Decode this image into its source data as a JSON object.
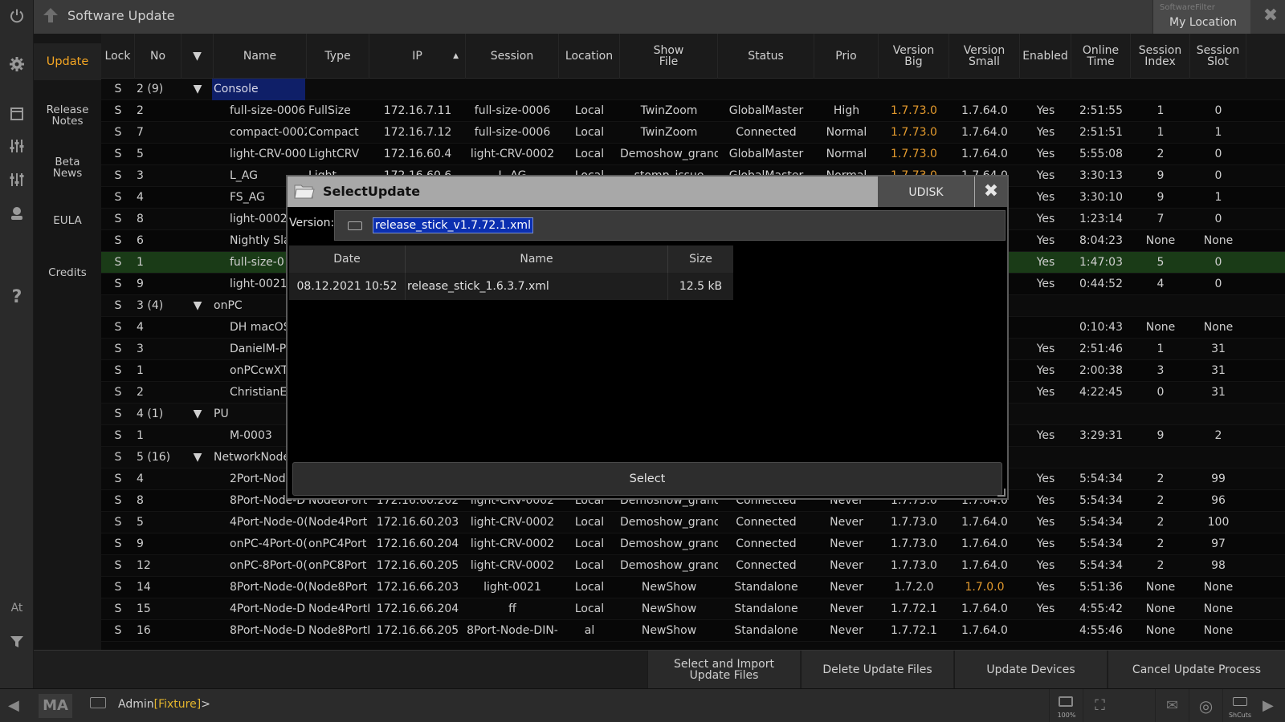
{
  "app": {
    "title": "Software Update",
    "filter_small": "SoftwareFilter",
    "filter_main": "My Location"
  },
  "rail": {
    "icons": [
      "power-icon",
      "gear-icon",
      "window-icon",
      "faders-icon",
      "faders-alt-icon",
      "user-icon",
      "help-icon",
      "filter-icon"
    ],
    "at_label": "At"
  },
  "sidemenu": {
    "update": "Update",
    "release_notes": "Release\nNotes",
    "beta_news": "Beta\nNews",
    "eula": "EULA",
    "credits": "Credits"
  },
  "table": {
    "headers": {
      "lock": "Lock",
      "no": "No",
      "name": "Name",
      "type": "Type",
      "ip": "IP",
      "session": "Session",
      "location": "Location",
      "show_file": "Show\nFile",
      "status": "Status",
      "prio": "Prio",
      "version_big": "Version\nBig",
      "version_small": "Version\nSmall",
      "enabled": "Enabled",
      "online_time": "Online\nTime",
      "session_index": "Session\nIndex",
      "session_slot": "Session\nSlot"
    },
    "rows": [
      {
        "kind": "group",
        "lock": "S",
        "no": "2 (9)",
        "name": "Console"
      },
      {
        "lock": "S",
        "no": "2",
        "name": "full-size-0006",
        "type": "FullSize",
        "ip": "172.16.7.11",
        "session": "full-size-0006",
        "location": "Local",
        "show": "TwinZoom",
        "status": "GlobalMaster",
        "prio": "High",
        "vbig": "1.7.73.0",
        "vbig_orange": true,
        "vsmall": "1.7.64.0",
        "enabled": "Yes",
        "online": "2:51:55",
        "sindex": "1",
        "sslot": "0"
      },
      {
        "lock": "S",
        "no": "7",
        "name": "compact-0002",
        "type": "Compact",
        "ip": "172.16.7.12",
        "session": "full-size-0006",
        "location": "Local",
        "show": "TwinZoom",
        "status": "Connected",
        "prio": "Normal",
        "vbig": "1.7.73.0",
        "vbig_orange": true,
        "vsmall": "1.7.64.0",
        "enabled": "Yes",
        "online": "2:51:51",
        "sindex": "1",
        "sslot": "1"
      },
      {
        "lock": "S",
        "no": "5",
        "name": "light-CRV-000",
        "type": "LightCRV",
        "ip": "172.16.60.4",
        "session": "light-CRV-0002",
        "location": "Local",
        "show": "Demoshow_grand",
        "status": "GlobalMaster",
        "prio": "Normal",
        "vbig": "1.7.73.0",
        "vbig_orange": true,
        "vsmall": "1.7.64.0",
        "enabled": "Yes",
        "online": "5:55:08",
        "sindex": "2",
        "sslot": "0"
      },
      {
        "lock": "S",
        "no": "3",
        "name": "L_AG",
        "type": "Light",
        "ip": "172.16.60.6",
        "session": "L_AG",
        "location": "Local",
        "show": "stomp_issue",
        "status": "GlobalMaster",
        "prio": "Normal",
        "vbig": "1.7.73.0",
        "vbig_orange": true,
        "vsmall": "1.7.64.0",
        "enabled": "Yes",
        "online": "3:30:13",
        "sindex": "9",
        "sslot": "0"
      },
      {
        "lock": "S",
        "no": "4",
        "name": "FS_AG",
        "type": "",
        "ip": "",
        "session": "",
        "location": "",
        "show": "",
        "status": "",
        "prio": "",
        "vbig": "",
        "vsmall": "",
        "enabled": "Yes",
        "online": "3:30:10",
        "sindex": "9",
        "sslot": "1"
      },
      {
        "lock": "S",
        "no": "8",
        "name": "light-0002",
        "type": "",
        "ip": "",
        "session": "",
        "location": "",
        "show": "",
        "status": "",
        "prio": "",
        "vbig": "",
        "vsmall": "",
        "enabled": "Yes",
        "online": "1:23:14",
        "sindex": "7",
        "sslot": "0"
      },
      {
        "lock": "S",
        "no": "6",
        "name": "Nightly Sla",
        "type": "",
        "ip": "",
        "session": "",
        "location": "",
        "show": "",
        "status": "",
        "prio": "",
        "vbig": "",
        "vsmall": "",
        "enabled": "Yes",
        "online": "8:04:23",
        "sindex": "None",
        "sslot": "None"
      },
      {
        "lock": "S",
        "no": "1",
        "name": "full-size-0",
        "sel": true,
        "type": "",
        "ip": "",
        "session": "",
        "location": "",
        "show": "",
        "status": "",
        "prio": "",
        "vbig": "",
        "vsmall": "",
        "enabled": "Yes",
        "online": "1:47:03",
        "sindex": "5",
        "sslot": "0"
      },
      {
        "lock": "S",
        "no": "9",
        "name": "light-0021",
        "type": "",
        "ip": "",
        "session": "",
        "location": "",
        "show": "",
        "status": "",
        "prio": "",
        "vbig": "",
        "vsmall": "",
        "enabled": "Yes",
        "online": "0:44:52",
        "sindex": "4",
        "sslot": "0"
      },
      {
        "kind": "group",
        "lock": "S",
        "no": "3 (4)",
        "name": "onPC"
      },
      {
        "lock": "S",
        "no": "4",
        "name": "DH macOS",
        "type": "",
        "ip": "",
        "session": "",
        "location": "",
        "show": "",
        "status": "",
        "prio": "",
        "vbig": "",
        "vsmall": "",
        "enabled": "",
        "online": "0:10:43",
        "sindex": "None",
        "sslot": "None"
      },
      {
        "lock": "S",
        "no": "3",
        "name": "DanielM-P",
        "type": "",
        "ip": "",
        "session": "",
        "location": "",
        "show": "",
        "status": "",
        "prio": "",
        "vbig": "",
        "vsmall": "",
        "enabled": "Yes",
        "online": "2:51:46",
        "sindex": "1",
        "sslot": "31"
      },
      {
        "lock": "S",
        "no": "1",
        "name": "onPCcwXT",
        "type": "",
        "ip": "",
        "session": "",
        "location": "",
        "show": "",
        "status": "",
        "prio": "",
        "vbig": "",
        "vsmall": "",
        "enabled": "Yes",
        "online": "2:00:38",
        "sindex": "3",
        "sslot": "31"
      },
      {
        "lock": "S",
        "no": "2",
        "name": "ChristianE",
        "type": "",
        "ip": "",
        "session": "",
        "location": "",
        "show": "",
        "status": "",
        "prio": "",
        "vbig": "",
        "vsmall": "",
        "enabled": "Yes",
        "online": "4:22:45",
        "sindex": "0",
        "sslot": "31"
      },
      {
        "kind": "group",
        "lock": "S",
        "no": "4 (1)",
        "name": "PU"
      },
      {
        "lock": "S",
        "no": "1",
        "name": "M-0003",
        "type": "",
        "ip": "",
        "session": "",
        "location": "",
        "show": "",
        "status": "",
        "prio": "",
        "vbig": "",
        "vsmall": "",
        "enabled": "Yes",
        "online": "3:29:31",
        "sindex": "9",
        "sslot": "2"
      },
      {
        "kind": "group",
        "lock": "S",
        "no": "5 (16)",
        "name": "NetworkNode"
      },
      {
        "lock": "S",
        "no": "4",
        "name": "2Port-Nod",
        "type": "",
        "ip": "",
        "session": "",
        "location": "",
        "show": "",
        "status": "",
        "prio": "",
        "vbig": "",
        "vsmall": "",
        "enabled": "Yes",
        "online": "5:54:34",
        "sindex": "2",
        "sslot": "99"
      },
      {
        "lock": "S",
        "no": "8",
        "name": "8Port-Node-D",
        "type": "Node8Port",
        "ip": "172.16.60.202",
        "session": "light-CRV-0002",
        "location": "Local",
        "show": "Demoshow_grand",
        "status": "Connected",
        "prio": "Never",
        "vbig": "1.7.73.0",
        "vsmall": "1.7.64.0",
        "enabled": "Yes",
        "online": "5:54:34",
        "sindex": "2",
        "sslot": "96"
      },
      {
        "lock": "S",
        "no": "5",
        "name": "4Port-Node-0(",
        "type": "Node4Port",
        "ip": "172.16.60.203",
        "session": "light-CRV-0002",
        "location": "Local",
        "show": "Demoshow_grand",
        "status": "Connected",
        "prio": "Never",
        "vbig": "1.7.73.0",
        "vsmall": "1.7.64.0",
        "enabled": "Yes",
        "online": "5:54:34",
        "sindex": "2",
        "sslot": "100"
      },
      {
        "lock": "S",
        "no": "9",
        "name": "onPC-4Port-0(",
        "type": "onPC4Port",
        "ip": "172.16.60.204",
        "session": "light-CRV-0002",
        "location": "Local",
        "show": "Demoshow_grand",
        "status": "Connected",
        "prio": "Never",
        "vbig": "1.7.73.0",
        "vsmall": "1.7.64.0",
        "enabled": "Yes",
        "online": "5:54:34",
        "sindex": "2",
        "sslot": "97"
      },
      {
        "lock": "S",
        "no": "12",
        "name": "onPC-8Port-0(",
        "type": "onPC8Port",
        "ip": "172.16.60.205",
        "session": "light-CRV-0002",
        "location": "Local",
        "show": "Demoshow_grand",
        "status": "Connected",
        "prio": "Never",
        "vbig": "1.7.73.0",
        "vsmall": "1.7.64.0",
        "enabled": "Yes",
        "online": "5:54:34",
        "sindex": "2",
        "sslot": "98"
      },
      {
        "lock": "S",
        "no": "14",
        "name": "8Port-Node-0(",
        "type": "Node8Port",
        "ip": "172.16.66.203",
        "session": "light-0021",
        "location": "Local",
        "show": "NewShow",
        "status": "Standalone",
        "prio": "Never",
        "vbig": "1.7.2.0",
        "vsmall": "1.7.0.0",
        "vsmall_orange": true,
        "enabled": "Yes",
        "online": "5:51:36",
        "sindex": "None",
        "sslot": "None"
      },
      {
        "lock": "S",
        "no": "15",
        "name": "4Port-Node-D",
        "type": "Node4PortD",
        "ip": "172.16.66.204",
        "session": "ff",
        "location": "Local",
        "show": "NewShow",
        "status": "Standalone",
        "prio": "Never",
        "vbig": "1.7.72.1",
        "vsmall": "1.7.64.0",
        "enabled": "Yes",
        "online": "4:55:42",
        "sindex": "None",
        "sslot": "None"
      },
      {
        "lock": "S",
        "no": "16",
        "name": "8Port-Node-D",
        "type": "Node8PortD",
        "ip": "172.16.66.205",
        "session": "8Port-Node-DIN-",
        "location": "al",
        "show": "NewShow",
        "status": "Standalone",
        "prio": "Never",
        "vbig": "1.7.72.1",
        "vsmall": "1.7.64.0",
        "enabled": "",
        "online": "4:55:46",
        "sindex": "None",
        "sslot": "None"
      }
    ]
  },
  "bottom": {
    "select_import": "Select and Import\nUpdate Files",
    "delete": "Delete Update Files",
    "update_devices": "Update Devices",
    "cancel": "Cancel Update Process"
  },
  "cmdline": {
    "prompt_user": "Admin",
    "prompt_obj": "[Fixture]",
    "prompt_end": ">",
    "zoom": "100%",
    "shcuts": "ShCuts"
  },
  "modal": {
    "title": "SelectUpdate",
    "drive": "UDISK",
    "version_label": "Version:",
    "version_value": "release_stick_v1.7.72.1.xml",
    "headers": {
      "date": "Date",
      "name": "Name",
      "size": "Size"
    },
    "files": [
      {
        "date": "08.12.2021 10:52",
        "name": "release_stick_1.6.3.7.xml",
        "size": "12.5 kB"
      }
    ],
    "select_label": "Select"
  }
}
